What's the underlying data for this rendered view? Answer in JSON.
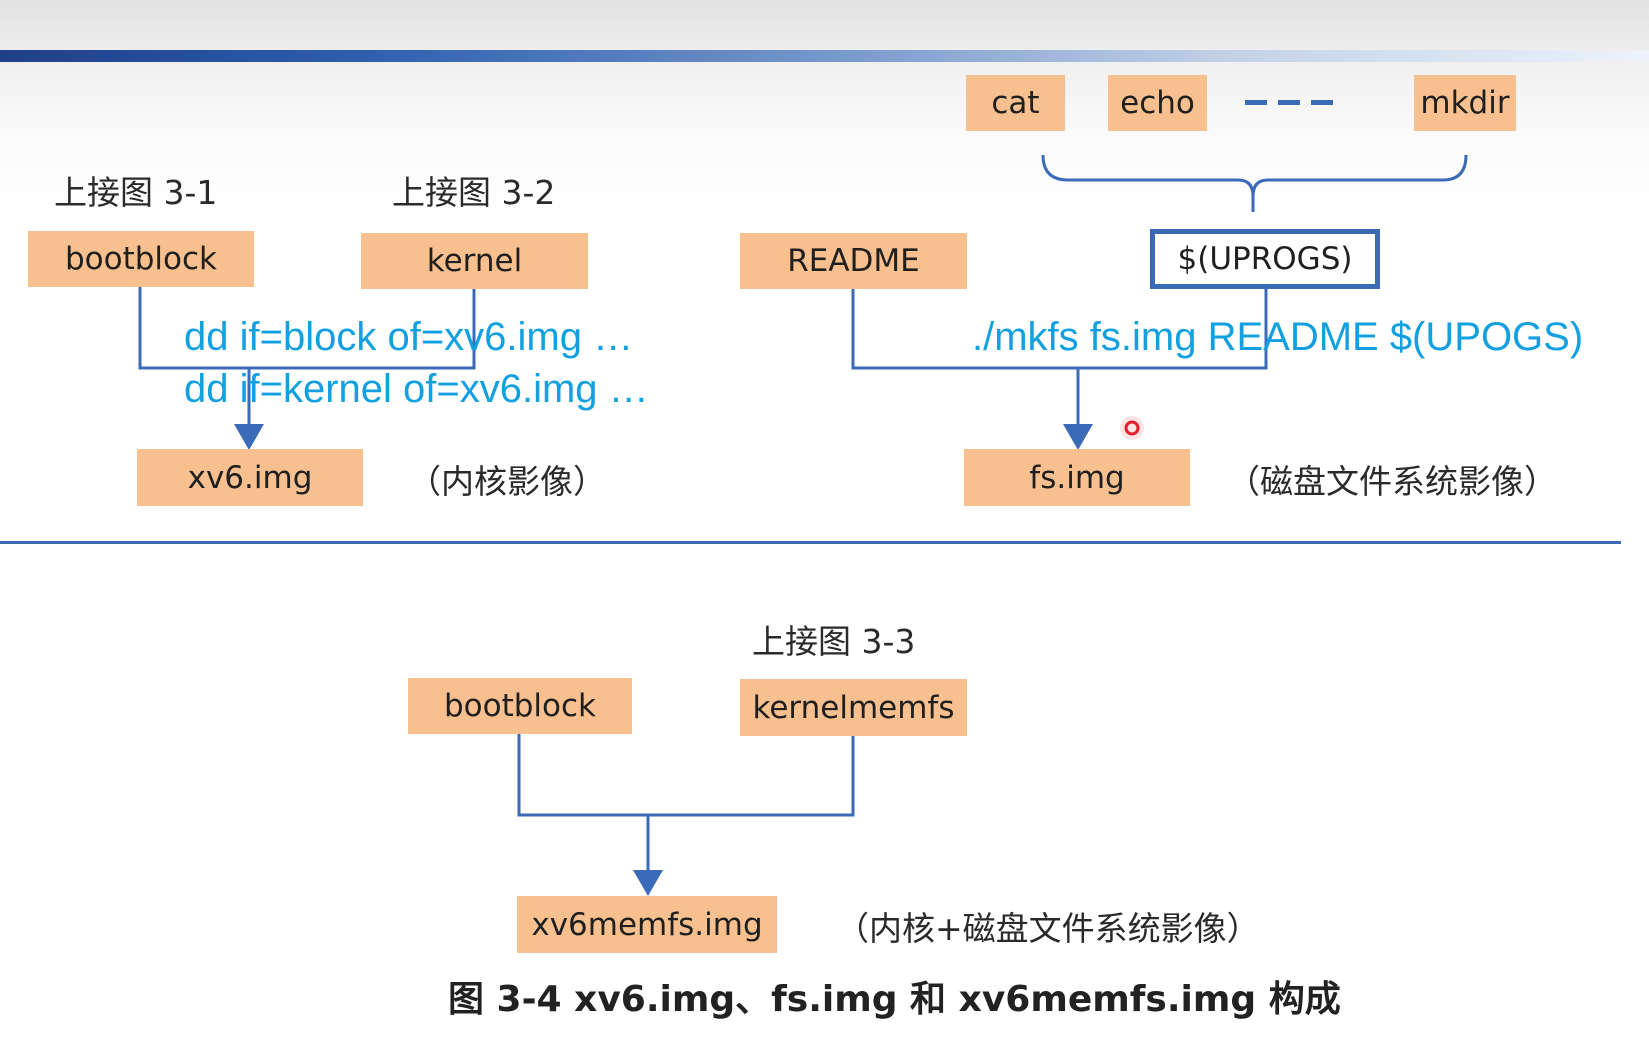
{
  "refs": {
    "ref1": "上接图 3-1",
    "ref2": "上接图 3-2",
    "ref3": "上接图 3-3"
  },
  "boxes": {
    "cat": "cat",
    "echo": "echo",
    "dashes": "- - -",
    "mkdir": "mkdir",
    "bootblock": "bootblock",
    "kernel": "kernel",
    "readme": "README",
    "uprogs": "$(UPROGS)",
    "xv6img": "xv6.img",
    "fsimg": "fs.img",
    "bootblock2": "bootblock",
    "kernelmemfs": "kernelmemfs",
    "xv6memfs": "xv6memfs.img"
  },
  "commands": {
    "dd1": "dd if=block of=xv6.img …",
    "dd2": "dd if=kernel of=xv6.img …",
    "mkfs": "./mkfs fs.img README $(UPOGS)"
  },
  "notes": {
    "kernel_image": "（内核影像）",
    "disk_image": "（磁盘文件系统影像）",
    "combined_image": "（内核+磁盘文件系统影像）"
  },
  "caption": "图 3-4 xv6.img、fs.img 和 xv6memfs.img 构成",
  "colors": {
    "box_fill": "#f8c08f",
    "connector": "#3b6ab8",
    "command_text": "#12a0e0",
    "cursor_dot": "#e0202a"
  }
}
